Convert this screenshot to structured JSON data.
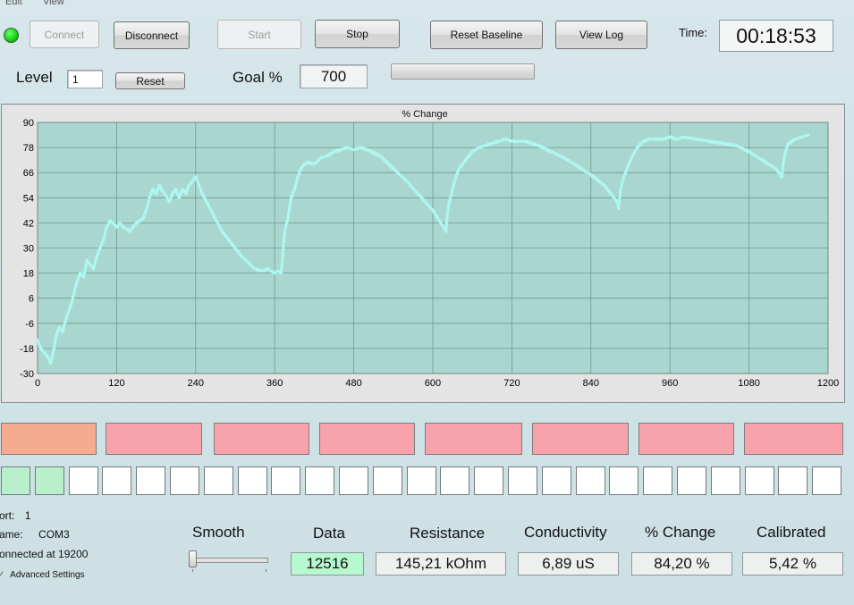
{
  "menubar": {
    "items": [
      "Edit",
      "View"
    ]
  },
  "toolbar": {
    "connect_label": "Connect",
    "disconnect_label": "Disconnect",
    "start_label": "Start",
    "stop_label": "Stop",
    "reset_baseline_label": "Reset Baseline",
    "view_log_label": "View Log",
    "time_label": "Time:",
    "time_value": "00:18:53"
  },
  "level": {
    "label": "Level",
    "value": "1",
    "reset_label": "Reset"
  },
  "goal": {
    "label": "Goal %",
    "value": "700",
    "progress": 0
  },
  "status_led_color": "#19d219",
  "chart_data": {
    "type": "scatter",
    "title": "% Change",
    "xlabel": "",
    "ylabel": "",
    "xlim": [
      0,
      1200
    ],
    "ylim": [
      -30,
      90
    ],
    "xticks": [
      "0",
      "120",
      "240",
      "360",
      "480",
      "600",
      "720",
      "840",
      "960",
      "1080",
      "1200"
    ],
    "yticks": [
      "90",
      "78",
      "66",
      "54",
      "42",
      "30",
      "18",
      "6",
      "-6",
      "-18",
      "-30"
    ],
    "grid": true,
    "background": "#a9d6cf",
    "point_color": "#aef7f0",
    "series": [
      {
        "x": [
          0,
          5,
          10,
          15,
          20,
          25,
          28,
          33,
          38,
          45,
          50,
          55,
          60,
          65,
          70,
          75,
          80,
          85,
          90,
          95,
          100,
          105,
          110,
          115,
          120,
          125,
          130,
          140,
          150,
          160,
          165,
          170,
          175,
          180,
          185,
          190,
          195,
          200,
          205,
          210,
          215,
          220,
          225,
          230,
          235,
          240,
          245,
          250,
          260,
          270,
          280,
          290,
          300,
          310,
          320,
          330,
          340,
          350,
          360,
          365,
          370,
          372,
          375,
          380,
          385,
          390,
          395,
          400,
          405,
          410,
          420,
          430,
          440,
          450,
          460,
          470,
          480,
          490,
          500,
          520,
          540,
          560,
          580,
          600,
          610,
          620,
          622,
          625,
          630,
          635,
          640,
          650,
          660,
          670,
          680,
          690,
          700,
          710,
          720,
          740,
          760,
          780,
          800,
          820,
          840,
          860,
          870,
          880,
          882,
          885,
          890,
          900,
          910,
          920,
          930,
          940,
          950,
          960,
          970,
          980,
          1000,
          1020,
          1040,
          1060,
          1080,
          1100,
          1120,
          1130,
          1132,
          1135,
          1140,
          1150,
          1160,
          1170
        ],
        "y": [
          -14,
          -18,
          -20,
          -22,
          -25,
          -18,
          -12,
          -8,
          -10,
          -2,
          2,
          8,
          14,
          18,
          16,
          24,
          22,
          20,
          26,
          30,
          34,
          40,
          43,
          42,
          40,
          42,
          40,
          38,
          42,
          44,
          48,
          54,
          58,
          56,
          60,
          57,
          55,
          52,
          56,
          58,
          54,
          58,
          56,
          60,
          62,
          64,
          60,
          56,
          50,
          44,
          38,
          34,
          30,
          26,
          23,
          20,
          19,
          20,
          18,
          19,
          18,
          26,
          38,
          44,
          54,
          58,
          64,
          68,
          70,
          71,
          70,
          73,
          74,
          76,
          77,
          78,
          77,
          78,
          77,
          74,
          68,
          62,
          55,
          48,
          43,
          38,
          46,
          52,
          58,
          64,
          68,
          72,
          76,
          78,
          79,
          80,
          81,
          82,
          81,
          81,
          79,
          76,
          73,
          69,
          65,
          60,
          56,
          52,
          49,
          58,
          64,
          72,
          78,
          81,
          82,
          82,
          82,
          83,
          82,
          83,
          82,
          81,
          80,
          79,
          76,
          72,
          68,
          64,
          70,
          76,
          80,
          82,
          83,
          84
        ]
      }
    ]
  },
  "indicators": {
    "colors": [
      "#f6ab90",
      "#f8a2ac",
      "#f8a2ac",
      "#f8a2ac",
      "#f8a2ac",
      "#f8a2ac",
      "#f8a2ac",
      "#f8a2ac"
    ]
  },
  "cells": {
    "active_color": "#b8f0cc",
    "active_count": 2,
    "count": 25
  },
  "connection": {
    "port_label": "ort:",
    "port_value": "1",
    "name_label": "ame:",
    "name_value": "COM3",
    "status_text": "onnected at 19200",
    "advanced_label": "Advanced Settings"
  },
  "smooth": {
    "label": "Smooth",
    "value": 0
  },
  "stats": {
    "data_label": "Data",
    "data_value": "12516",
    "data_color": "#b8f8cf",
    "resistance_label": "Resistance",
    "resistance_value": "145,21 kOhm",
    "conductivity_label": "Conductivity",
    "conductivity_value": "6,89 uS",
    "change_label": "% Change",
    "change_value": "84,20 %",
    "calibrated_label": "Calibrated",
    "calibrated_value": "5,42 %"
  }
}
